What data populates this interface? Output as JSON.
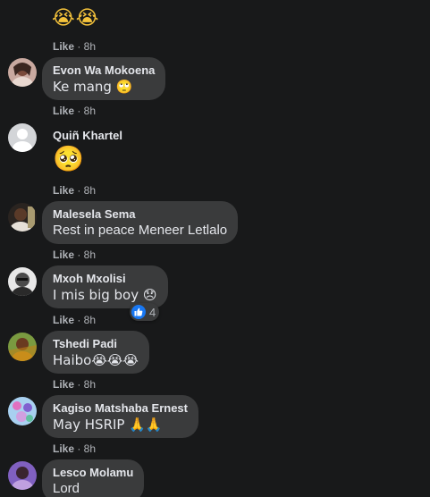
{
  "top": {
    "emoji": "😭😭",
    "like_label": "Like",
    "time": " · 8h"
  },
  "comments": [
    {
      "author": "Evon Wa Mokoena",
      "text": "Ke mang 🙄",
      "like_label": "Like",
      "time": " · 8h"
    },
    {
      "author": "Quiñ Khartel",
      "text": "🥺",
      "like_label": "Like",
      "time": " · 8h"
    },
    {
      "author": "Malesela Sema",
      "text": "Rest in peace Meneer Letlalo",
      "like_label": "Like",
      "time": " · 8h"
    },
    {
      "author": "Mxoh Mxolisi",
      "text": "I mis big boy 😞",
      "like_label": "Like",
      "time": " · 8h",
      "reaction_icon": "thumbs-up-icon",
      "reaction_count": "4"
    },
    {
      "author": "Tshedi Padi",
      "text": "Haibo😭😭😭",
      "like_label": "Like",
      "time": " · 8h"
    },
    {
      "author": "Kagiso Matshaba Ernest",
      "text": "May HSRIP 🙏🙏",
      "like_label": "Like",
      "time": " · 8h"
    },
    {
      "author": "Lesco Molamu",
      "text": "Lord"
    }
  ],
  "colors": {
    "background": "#18191a",
    "bubble": "#3a3b3c",
    "text": "#e4e6eb",
    "meta": "#b0b3b8",
    "like_badge": "#1877f2"
  }
}
